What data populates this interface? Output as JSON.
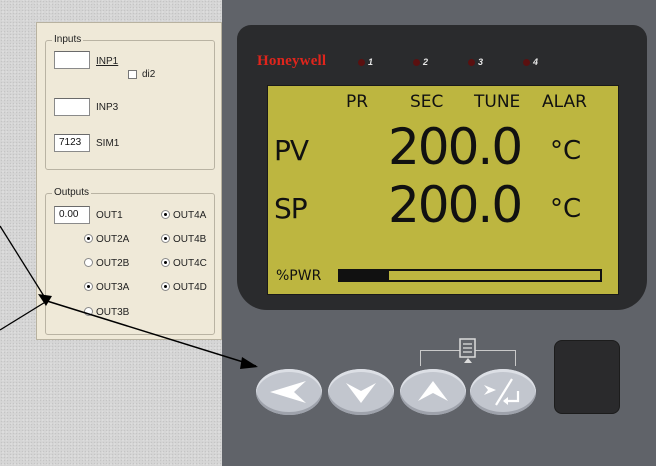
{
  "simulator": {
    "inputs": {
      "legend": "Inputs",
      "inp1": {
        "value": "",
        "label": "INP1"
      },
      "di2": {
        "label": "di2",
        "checked": false
      },
      "inp3": {
        "value": "",
        "label": "INP3"
      },
      "sim1": {
        "value": "7123",
        "label": "SIM1"
      }
    },
    "outputs": {
      "legend": "Outputs",
      "out1": {
        "value": "0.00",
        "label": "OUT1"
      },
      "radios": {
        "out4a": {
          "label": "OUT4A",
          "selected": true
        },
        "out2a": {
          "label": "OUT2A",
          "selected": true
        },
        "out4b": {
          "label": "OUT4B",
          "selected": true
        },
        "out2b": {
          "label": "OUT2B",
          "selected": false
        },
        "out4c": {
          "label": "OUT4C",
          "selected": true
        },
        "out3a": {
          "label": "OUT3A",
          "selected": true
        },
        "out4d": {
          "label": "OUT4D",
          "selected": true
        },
        "out3b": {
          "label": "OUT3B",
          "selected": false
        }
      }
    }
  },
  "controller": {
    "brand": "Honeywell",
    "brand_color": "#e0251c",
    "leds": [
      "1",
      "2",
      "3",
      "4"
    ],
    "display": {
      "headers": [
        "PR",
        "SEC",
        "TUNE",
        "ALAR"
      ],
      "pv_label": "PV",
      "pv_value": "200.0",
      "pv_unit": "°C",
      "sp_label": "SP",
      "sp_value": "200.0",
      "sp_unit": "°C",
      "pwr_label": "%PWR",
      "pwr_fraction": 0.19,
      "lcd_color": "#bdb640"
    },
    "keys": [
      "left-arrow-icon",
      "down-arrow-icon",
      "up-arrow-icon",
      "scroll-enter-icon"
    ]
  }
}
